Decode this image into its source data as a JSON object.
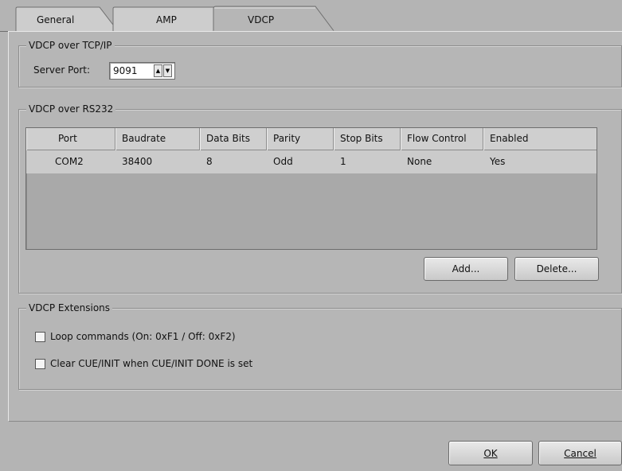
{
  "tabs": [
    {
      "label": "General",
      "active": false
    },
    {
      "label": "AMP",
      "active": false
    },
    {
      "label": "VDCP",
      "active": true
    }
  ],
  "tcp": {
    "legend": "VDCP over TCP/IP",
    "server_port_label": "Server Port:",
    "server_port_value": "9091"
  },
  "rs232": {
    "legend": "VDCP over RS232",
    "columns": [
      "Port",
      "Baudrate",
      "Data Bits",
      "Parity",
      "Stop Bits",
      "Flow Control",
      "Enabled"
    ],
    "rows": [
      [
        "COM2",
        "38400",
        "8",
        "Odd",
        "1",
        "None",
        "Yes"
      ]
    ],
    "add_label": "Add...",
    "delete_label": "Delete..."
  },
  "extensions": {
    "legend": "VDCP Extensions",
    "loop_commands": {
      "label": "Loop commands (On: 0xF1 / Off: 0xF2)",
      "checked": false
    },
    "clear_cue": {
      "label": "Clear CUE/INIT when CUE/INIT DONE is set",
      "checked": false
    }
  },
  "dialog": {
    "ok_label": "OK",
    "cancel_label": "Cancel"
  },
  "icons": {
    "spin_up": "triangle-up-icon",
    "spin_down": "triangle-down-icon"
  }
}
